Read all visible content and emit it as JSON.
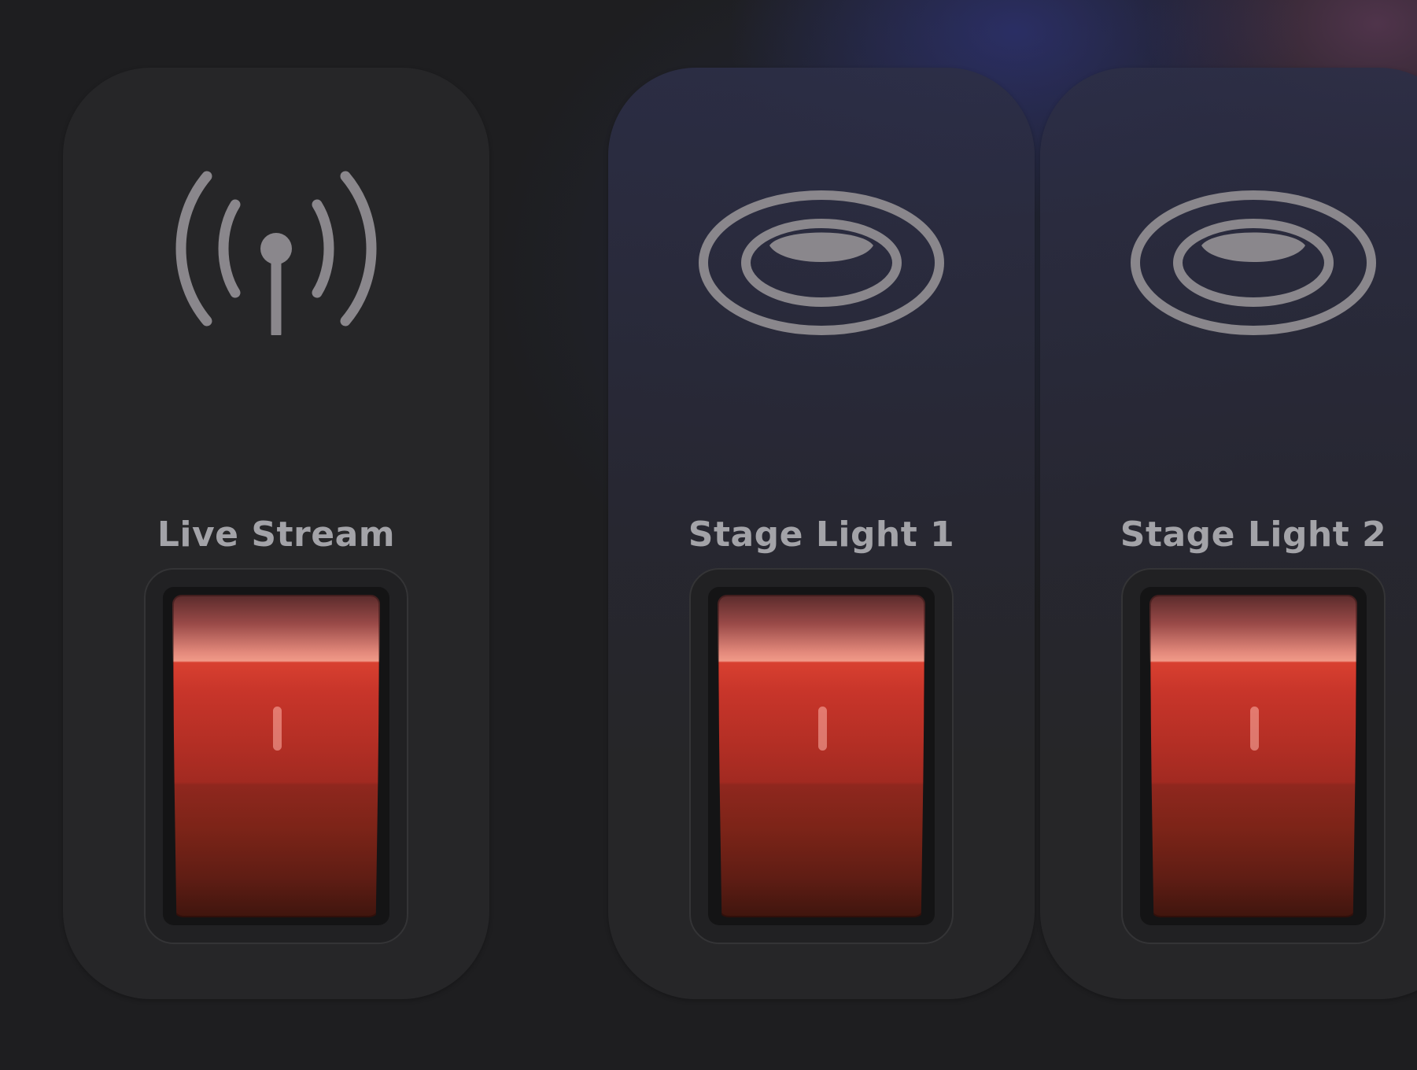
{
  "colors": {
    "background": "#1e1e20",
    "card": "#262628",
    "icon": "#8a878c",
    "label": "#a3a3a8",
    "switch_red": "#d0382b"
  },
  "controls": [
    {
      "label": "Live Stream",
      "icon": "broadcast-antenna-icon",
      "state": "on",
      "mark": "I"
    },
    {
      "label": "Stage Light 1",
      "icon": "recessed-light-icon",
      "state": "on",
      "mark": "I"
    },
    {
      "label": "Stage Light 2",
      "icon": "recessed-light-icon",
      "state": "on",
      "mark": "I"
    }
  ]
}
